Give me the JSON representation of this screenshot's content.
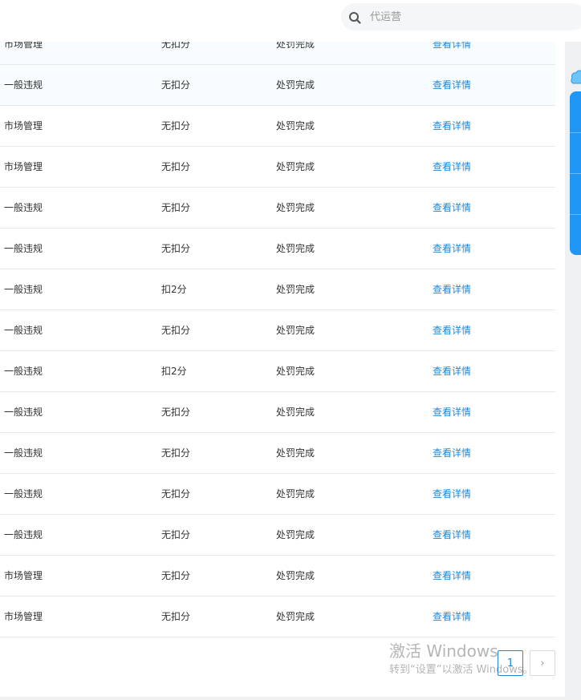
{
  "search": {
    "placeholder": "代运营"
  },
  "table": {
    "rows": [
      {
        "category": "市场管理",
        "deduction": "无扣分",
        "status": "处罚完成",
        "action": "查看详情"
      },
      {
        "category": "一般违规",
        "deduction": "无扣分",
        "status": "处罚完成",
        "action": "查看详情"
      },
      {
        "category": "市场管理",
        "deduction": "无扣分",
        "status": "处罚完成",
        "action": "查看详情"
      },
      {
        "category": "市场管理",
        "deduction": "无扣分",
        "status": "处罚完成",
        "action": "查看详情"
      },
      {
        "category": "一般违规",
        "deduction": "无扣分",
        "status": "处罚完成",
        "action": "查看详情"
      },
      {
        "category": "一般违规",
        "deduction": "无扣分",
        "status": "处罚完成",
        "action": "查看详情"
      },
      {
        "category": "一般违规",
        "deduction": "扣2分",
        "status": "处罚完成",
        "action": "查看详情"
      },
      {
        "category": "一般违规",
        "deduction": "无扣分",
        "status": "处罚完成",
        "action": "查看详情"
      },
      {
        "category": "一般违规",
        "deduction": "扣2分",
        "status": "处罚完成",
        "action": "查看详情"
      },
      {
        "category": "一般违规",
        "deduction": "无扣分",
        "status": "处罚完成",
        "action": "查看详情"
      },
      {
        "category": "一般违规",
        "deduction": "无扣分",
        "status": "处罚完成",
        "action": "查看详情"
      },
      {
        "category": "一般违规",
        "deduction": "无扣分",
        "status": "处罚完成",
        "action": "查看详情"
      },
      {
        "category": "一般违规",
        "deduction": "无扣分",
        "status": "处罚完成",
        "action": "查看详情"
      },
      {
        "category": "市场管理",
        "deduction": "无扣分",
        "status": "处罚完成",
        "action": "查看详情"
      },
      {
        "category": "市场管理",
        "deduction": "无扣分",
        "status": "处罚完成",
        "action": "查看详情"
      }
    ]
  },
  "pagination": {
    "current_page": "1",
    "next_label": "›"
  },
  "watermark": {
    "line1": "激活 Windows",
    "line2": "转到“设置”以激活 Windows。"
  },
  "colors": {
    "link": "#1e88d6",
    "accent": "#1f96f3"
  }
}
